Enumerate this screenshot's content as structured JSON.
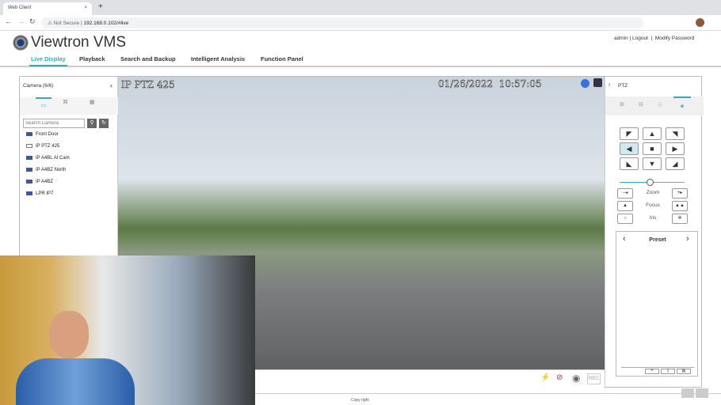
{
  "browser": {
    "tab_title": "Web Client",
    "security": "Not Secure",
    "url": "192.168.0.102/#live"
  },
  "header": {
    "logo": "Viewtron VMS",
    "user": "admin | Logout",
    "sep": "|",
    "modify": "Modify Password",
    "nav": [
      {
        "label": "Live Display",
        "active": true
      },
      {
        "label": "Playback"
      },
      {
        "label": "Search and Backup"
      },
      {
        "label": "Intelligent Analysis"
      },
      {
        "label": "Function Panel"
      }
    ]
  },
  "left": {
    "title": "Camera (6/6)",
    "search_placeholder": "Search Camera",
    "cameras": [
      "Front Door",
      "IP PTZ 425",
      "IP A4BL AI Cam",
      "IP A4BZ North",
      "IP A4BZ",
      "LPR IP7"
    ]
  },
  "video": {
    "osd_name": "IP PTZ 425",
    "osd_time": "01/26/2022  10:57:05",
    "record_dot_color": "#3b6fe0"
  },
  "ptz": {
    "title": "PTZ",
    "zoom": "Zoom",
    "focus": "Focus",
    "iris": "Iris",
    "preset": "Preset",
    "speed_percent": 45
  },
  "footer": {
    "copyright": "Copy right"
  },
  "colors": {
    "accent": "#3aa9b5"
  }
}
